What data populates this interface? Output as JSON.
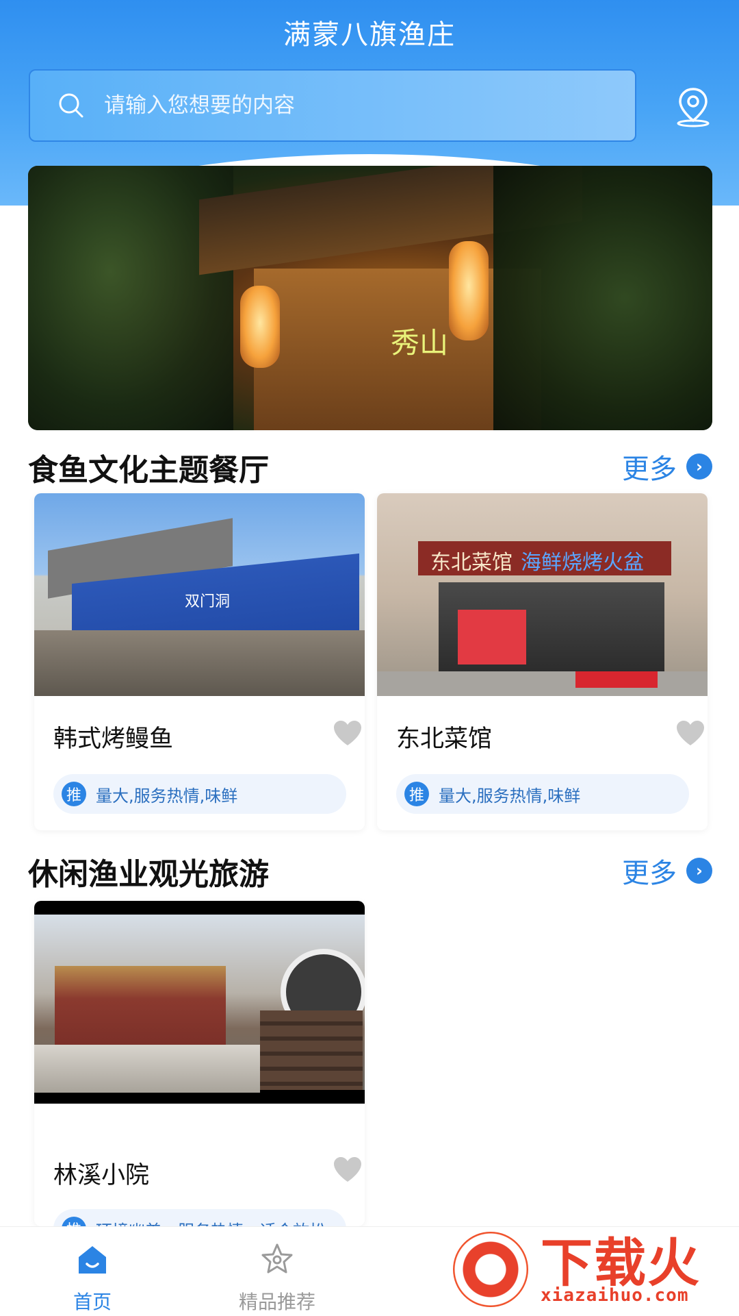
{
  "header": {
    "title": "满蒙八旗渔庄",
    "search_placeholder": "请输入您想要的内容"
  },
  "banner": {
    "sign_text": "秀山"
  },
  "sections": [
    {
      "title": "食鱼文化主题餐厅",
      "more_label": "更多",
      "cards": [
        {
          "name": "韩式烤鳗鱼",
          "badge": "推",
          "tags": "量大,服务热情,味鲜",
          "image_sign": "双门洞"
        },
        {
          "name": "东北菜馆",
          "badge": "推",
          "tags": "量大,服务热情,味鲜",
          "image_sign": "东北菜馆",
          "image_sign2": "海鲜烧烤火盆"
        }
      ]
    },
    {
      "title": "休闲渔业观光旅游",
      "more_label": "更多",
      "cards": [
        {
          "name": "林溪小院",
          "badge": "推",
          "tags": "环境幽美，服务热情，适合放松"
        }
      ]
    }
  ],
  "tabbar": {
    "items": [
      {
        "label": "首页",
        "icon": "home-icon",
        "active": true
      },
      {
        "label": "精品推荐",
        "icon": "star-icon",
        "active": false
      }
    ],
    "active_color": "#2b84e4",
    "inactive_color": "#9a9a9a"
  },
  "watermark": {
    "brand": "下载火",
    "url": "xiazaihuo.com"
  },
  "colors": {
    "accent": "#2b84e4",
    "header_top": "#2f8ff0"
  }
}
